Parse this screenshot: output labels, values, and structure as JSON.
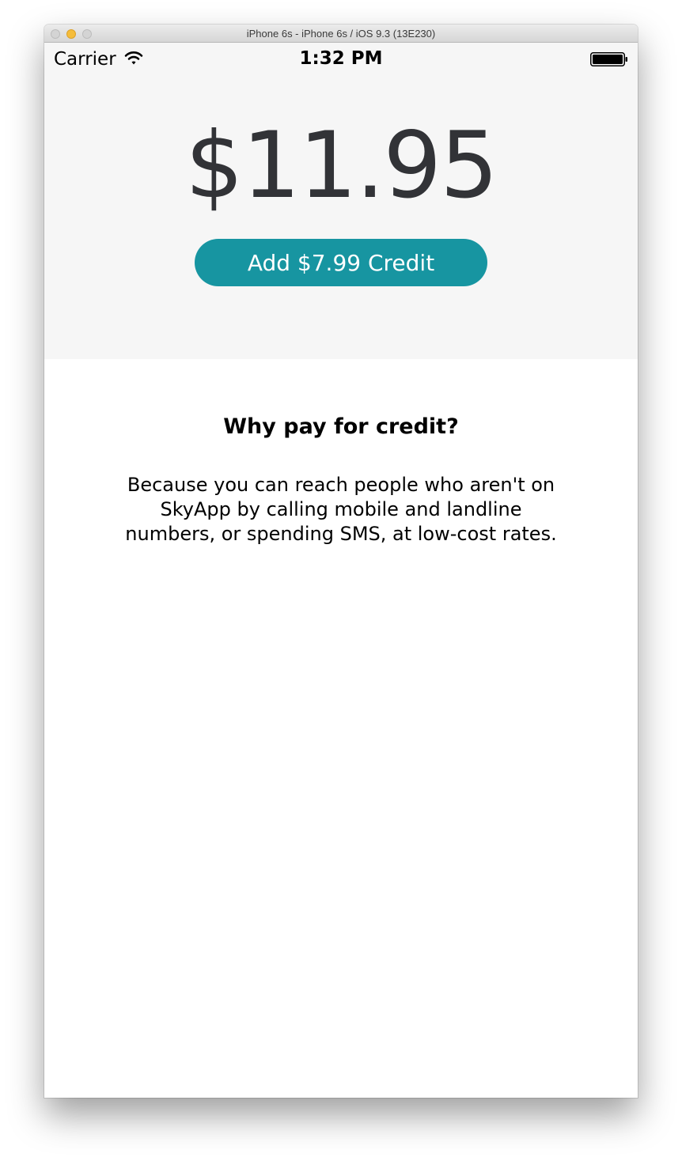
{
  "window": {
    "title": "iPhone 6s - iPhone 6s / iOS 9.3 (13E230)"
  },
  "status_bar": {
    "carrier": "Carrier",
    "time": "1:32 PM",
    "icons": [
      "wifi-icon",
      "battery-icon"
    ]
  },
  "balance": {
    "amount": "$11.95"
  },
  "credit_button": {
    "label": "Add $7.99 Credit",
    "color": "#1795a1"
  },
  "info": {
    "heading": "Why pay for credit?",
    "description": "Because you can reach people who aren't on SkyApp by calling mobile and landline numbers, or spending SMS, at low-cost rates."
  },
  "colors": {
    "top_background": "#f6f6f6",
    "balance_text": "#323337",
    "accent": "#1795a1"
  }
}
